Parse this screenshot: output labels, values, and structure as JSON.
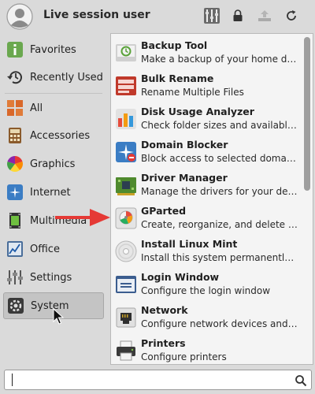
{
  "header": {
    "username": "Live session user",
    "icons": [
      "user-avatar-icon",
      "system-settings-icon",
      "lock-screen-icon",
      "switch-user-icon",
      "logout-icon"
    ]
  },
  "sidebar": {
    "items": [
      {
        "label": "Favorites",
        "icon": "favorites-icon",
        "selected": false
      },
      {
        "label": "Recently Used",
        "icon": "history-icon",
        "selected": false
      },
      {
        "label": "All",
        "icon": "all-apps-icon",
        "selected": false
      },
      {
        "label": "Accessories",
        "icon": "accessories-icon",
        "selected": false
      },
      {
        "label": "Graphics",
        "icon": "graphics-icon",
        "selected": false
      },
      {
        "label": "Internet",
        "icon": "internet-icon",
        "selected": false
      },
      {
        "label": "Multimedia",
        "icon": "multimedia-icon",
        "selected": false
      },
      {
        "label": "Office",
        "icon": "office-icon",
        "selected": false
      },
      {
        "label": "Settings",
        "icon": "settings-icon",
        "selected": false
      },
      {
        "label": "System",
        "icon": "system-icon",
        "selected": true
      }
    ]
  },
  "apps": [
    {
      "name": "Backup Tool",
      "desc": "Make a backup of your home dire...",
      "icon": "backup-tool-icon"
    },
    {
      "name": "Bulk Rename",
      "desc": "Rename Multiple Files",
      "icon": "bulk-rename-icon"
    },
    {
      "name": "Disk Usage Analyzer",
      "desc": "Check folder sizes and available d...",
      "icon": "disk-usage-icon"
    },
    {
      "name": "Domain Blocker",
      "desc": "Block access to selected domain ...",
      "icon": "domain-blocker-icon"
    },
    {
      "name": "Driver Manager",
      "desc": "Manage the drivers for your devic...",
      "icon": "driver-manager-icon"
    },
    {
      "name": "GParted",
      "desc": "Create, reorganize, and delete pa...",
      "icon": "gparted-icon"
    },
    {
      "name": "Install Linux Mint",
      "desc": "Install this system permanently t...",
      "icon": "install-disc-icon"
    },
    {
      "name": "Login Window",
      "desc": "Configure the login window",
      "icon": "login-window-icon"
    },
    {
      "name": "Network",
      "desc": "Configure network devices and co...",
      "icon": "network-icon"
    },
    {
      "name": "Printers",
      "desc": "Configure printers",
      "icon": "printer-icon"
    }
  ],
  "search": {
    "value": "",
    "placeholder": ""
  },
  "colors": {
    "annotation_arrow": "#e53935",
    "scroll_thumb": "#9e9e9e"
  }
}
